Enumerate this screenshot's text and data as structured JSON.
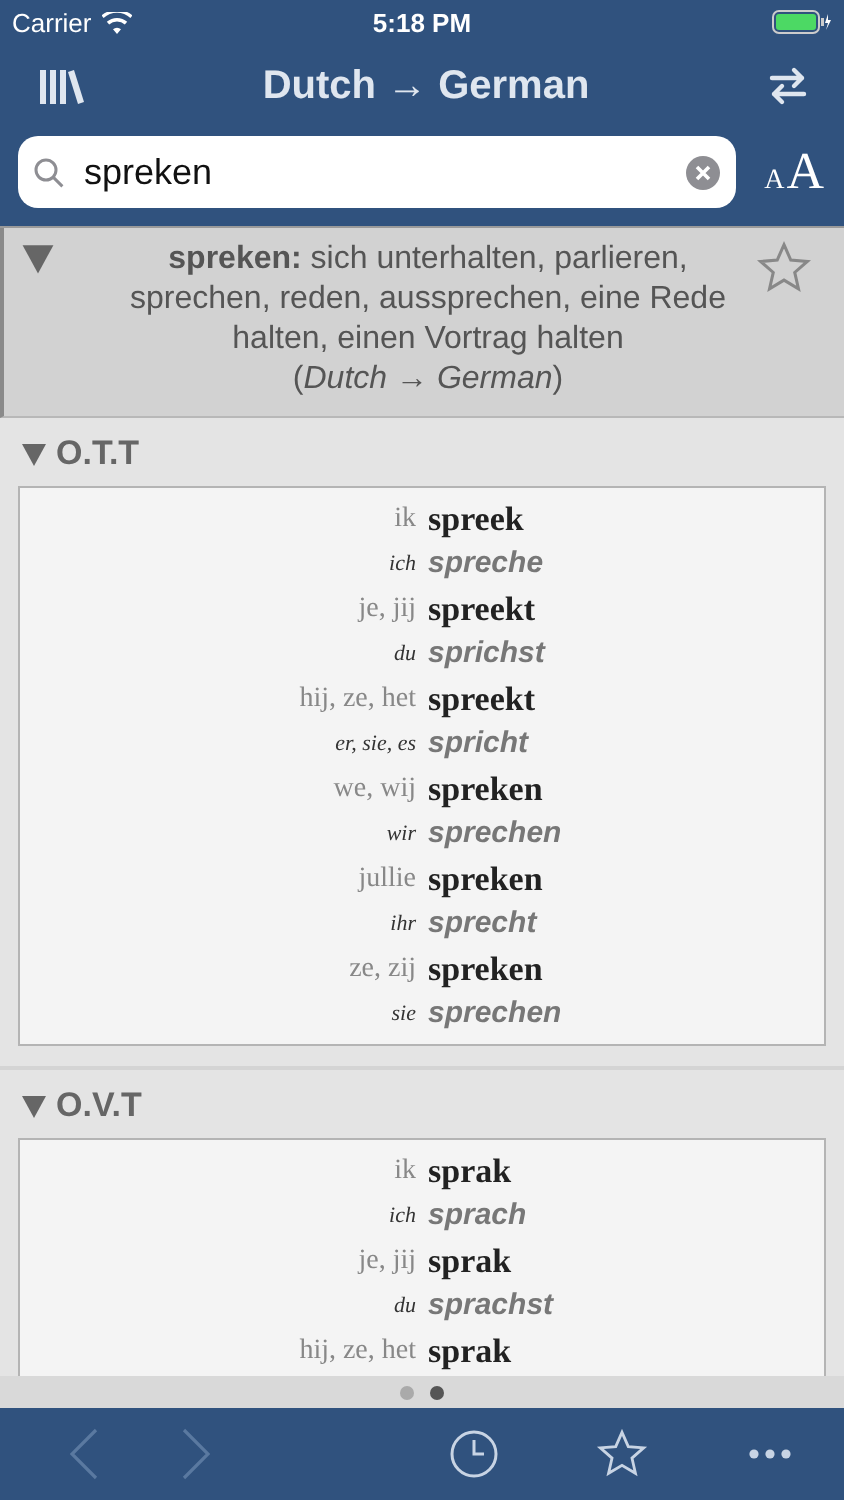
{
  "status_bar": {
    "carrier": "Carrier",
    "time": "5:18 PM"
  },
  "nav": {
    "title": "Dutch → German"
  },
  "search": {
    "value": "spreken",
    "text_size_label_small": "A",
    "text_size_label_large": "A"
  },
  "entry": {
    "text": "**spreken:** sich unterhalten, parlieren, sprechen, reden, aussprechen, eine Rede halten, einen Vortrag halten",
    "direction": "(*Dutch → German*)",
    "expanded": true,
    "favorite": false
  },
  "sections": [
    {
      "title": "O.T.T",
      "expanded": true,
      "rows": [
        {
          "kind": "dutch",
          "pronoun": "ik",
          "verb": "spreek"
        },
        {
          "kind": "german",
          "pronoun": "ich",
          "verb": "spreche"
        },
        {
          "kind": "dutch",
          "pronoun": "je, jij",
          "verb": "spreekt"
        },
        {
          "kind": "german",
          "pronoun": "du",
          "verb": "sprichst"
        },
        {
          "kind": "dutch",
          "pronoun": "hij, ze, het",
          "verb": "spreekt"
        },
        {
          "kind": "german",
          "pronoun": "er, sie, es",
          "verb": "spricht"
        },
        {
          "kind": "dutch",
          "pronoun": "we, wij",
          "verb": "spreken"
        },
        {
          "kind": "german",
          "pronoun": "wir",
          "verb": "sprechen"
        },
        {
          "kind": "dutch",
          "pronoun": "jullie",
          "verb": "spreken"
        },
        {
          "kind": "german",
          "pronoun": "ihr",
          "verb": "sprecht"
        },
        {
          "kind": "dutch",
          "pronoun": "ze, zij",
          "verb": "spreken"
        },
        {
          "kind": "german",
          "pronoun": "sie",
          "verb": "sprechen"
        }
      ]
    },
    {
      "title": "O.V.T",
      "expanded": true,
      "rows": [
        {
          "kind": "dutch",
          "pronoun": "ik",
          "verb": "sprak"
        },
        {
          "kind": "german",
          "pronoun": "ich",
          "verb": "sprach"
        },
        {
          "kind": "dutch",
          "pronoun": "je, jij",
          "verb": "sprak"
        },
        {
          "kind": "german",
          "pronoun": "du",
          "verb": "sprachst"
        },
        {
          "kind": "dutch",
          "pronoun": "hij, ze, het",
          "verb": "sprak"
        }
      ]
    }
  ],
  "pages": [
    {
      "selected": false
    },
    {
      "selected": true
    }
  ],
  "toolbar": {
    "back_disabled": true,
    "forward_disabled": true
  }
}
